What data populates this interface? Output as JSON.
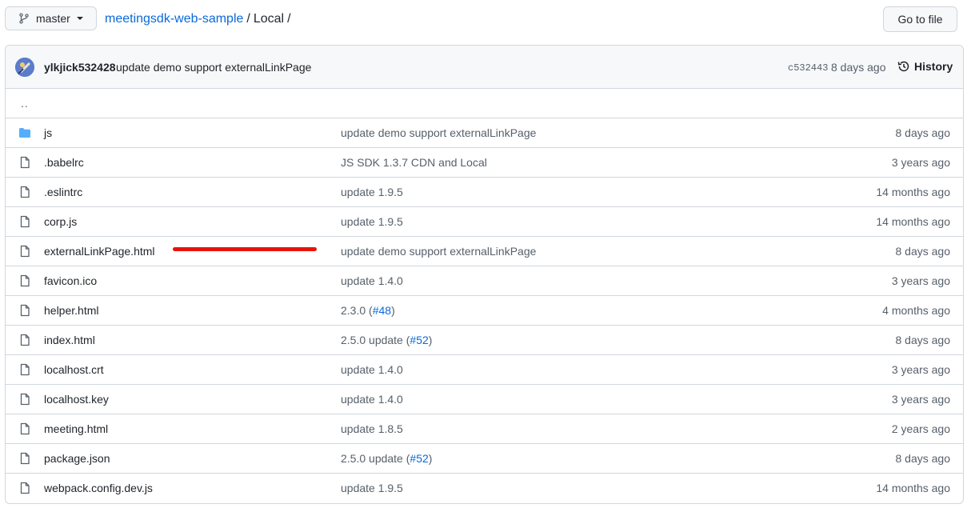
{
  "header": {
    "branch": "master",
    "breadcrumb": {
      "repo": "meetingsdk-web-sample",
      "sep1": "/",
      "folder": "Local",
      "sep2": "/"
    },
    "goto_label": "Go to file"
  },
  "commit": {
    "author": "ylkjick532428",
    "message": "update demo support externalLinkPage",
    "sha": "c532443",
    "age": "8 days ago",
    "history_label": "History"
  },
  "parent_dir": "..",
  "files": [
    {
      "name": "js",
      "type": "folder",
      "msg_pre": "update demo support externalLinkPage",
      "pr": "",
      "msg_post": "",
      "age": "8 days ago"
    },
    {
      "name": ".babelrc",
      "type": "file",
      "msg_pre": "JS SDK 1.3.7 CDN and Local",
      "pr": "",
      "msg_post": "",
      "age": "3 years ago"
    },
    {
      "name": ".eslintrc",
      "type": "file",
      "msg_pre": "update 1.9.5",
      "pr": "",
      "msg_post": "",
      "age": "14 months ago"
    },
    {
      "name": "corp.js",
      "type": "file",
      "msg_pre": "update 1.9.5",
      "pr": "",
      "msg_post": "",
      "age": "14 months ago"
    },
    {
      "name": "externalLinkPage.html",
      "type": "file",
      "msg_pre": "update demo support externalLinkPage",
      "pr": "",
      "msg_post": "",
      "age": "8 days ago"
    },
    {
      "name": "favicon.ico",
      "type": "file",
      "msg_pre": "update 1.4.0",
      "pr": "",
      "msg_post": "",
      "age": "3 years ago"
    },
    {
      "name": "helper.html",
      "type": "file",
      "msg_pre": "2.3.0 (",
      "pr": "#48",
      "msg_post": ")",
      "age": "4 months ago"
    },
    {
      "name": "index.html",
      "type": "file",
      "msg_pre": "2.5.0 update (",
      "pr": "#52",
      "msg_post": ")",
      "age": "8 days ago"
    },
    {
      "name": "localhost.crt",
      "type": "file",
      "msg_pre": "update 1.4.0",
      "pr": "",
      "msg_post": "",
      "age": "3 years ago"
    },
    {
      "name": "localhost.key",
      "type": "file",
      "msg_pre": "update 1.4.0",
      "pr": "",
      "msg_post": "",
      "age": "3 years ago"
    },
    {
      "name": "meeting.html",
      "type": "file",
      "msg_pre": "update 1.8.5",
      "pr": "",
      "msg_post": "",
      "age": "2 years ago"
    },
    {
      "name": "package.json",
      "type": "file",
      "msg_pre": "2.5.0 update (",
      "pr": "#52",
      "msg_post": ")",
      "age": "8 days ago"
    },
    {
      "name": "webpack.config.dev.js",
      "type": "file",
      "msg_pre": "update 1.9.5",
      "pr": "",
      "msg_post": "",
      "age": "14 months ago"
    }
  ],
  "colors": {
    "link": "#0969da",
    "folder": "#54aeff",
    "annotation": "#e8140c"
  }
}
